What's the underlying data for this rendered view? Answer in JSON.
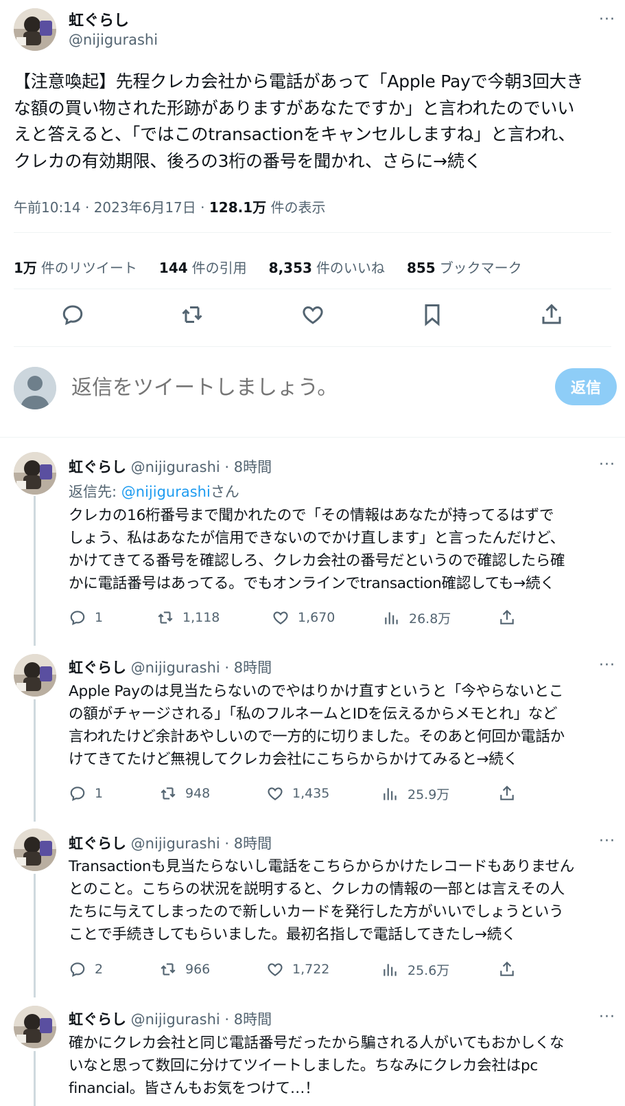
{
  "main": {
    "name": "虹ぐらし",
    "handle": "@nijigurashi",
    "more": "···",
    "text_lines": [
      "【注意喚起】先程クレカ会社から電話があって「Apple Payで今朝3回大き",
      "な額の買い物された形跡がありますがあなたですか」と言われたのでいい",
      "えと答えると、「ではこのtransactionをキャンセルしますね」と言われ、",
      "クレカの有効期限、後ろの3桁の番号を聞かれ、さらに→続く"
    ],
    "time": "午前10:14 · 2023年6月17日 · ",
    "views_count": "128.1万",
    "views_label": " 件の表示",
    "stats": [
      {
        "count": "1万",
        "label": "件のリツイート"
      },
      {
        "count": "144",
        "label": "件の引用"
      },
      {
        "count": "8,353",
        "label": "件のいいね"
      },
      {
        "count": "855",
        "label": "ブックマーク"
      }
    ],
    "action_icons": [
      "reply-icon",
      "retweet-icon",
      "like-icon",
      "bookmark-icon",
      "share-icon"
    ]
  },
  "reply_box": {
    "placeholder": "返信をツイートしましょう。",
    "button": "返信"
  },
  "replies": [
    {
      "name": "虹ぐらし",
      "handle": " @nijigurashi · 8時間",
      "reply_to_prefix": "返信先: ",
      "reply_to_handle": "@nijigurashi",
      "reply_to_suffix": "さん",
      "text_lines": [
        "クレカの16桁番号まで聞かれたので「その情報はあなたが持ってるはずで",
        "しょう、私はあなたが信用できないのでかけ直します」と言ったんだけど、",
        "かけてきてる番号を確認しろ、クレカ会社の番号だというので確認したら確",
        "かに電話番号はあってる。でもオンラインでtransaction確認しても→続く"
      ],
      "replies": "1",
      "retweets": "1,118",
      "likes": "1,670",
      "views": "26.8万"
    },
    {
      "name": "虹ぐらし",
      "handle": " @nijigurashi · 8時間",
      "text_lines": [
        "Apple Payのは見当たらないのでやはりかけ直すというと「今やらないとこ",
        "の額がチャージされる」「私のフルネームとIDを伝えるからメモとれ」など",
        "言われたけど余計あやしいので一方的に切りました。そのあと何回か電話か",
        "けてきてたけど無視してクレカ会社にこちらからかけてみると→続く"
      ],
      "replies": "1",
      "retweets": "948",
      "likes": "1,435",
      "views": "25.9万"
    },
    {
      "name": "虹ぐらし",
      "handle": " @nijigurashi · 8時間",
      "text_lines": [
        "Transactionも見当たらないし電話をこちらからかけたレコードもありません",
        "とのこと。こちらの状況を説明すると、クレカの情報の一部とは言えその人",
        "たちに与えてしまったので新しいカードを発行した方がいいでしょうという",
        "ことで手続きしてもらいました。最初名指しで電話してきたし→続く"
      ],
      "replies": "2",
      "retweets": "966",
      "likes": "1,722",
      "views": "25.6万"
    },
    {
      "name": "虹ぐらし",
      "handle": " @nijigurashi · 8時間",
      "text_lines": [
        "確かにクレカ会社と同じ電話番号だったから騙される人がいてもおかしくな",
        "いなと思って数回に分けてツイートしました。ちなみにクレカ会社はpc",
        "financial。皆さんもお気をつけて…！"
      ]
    }
  ]
}
